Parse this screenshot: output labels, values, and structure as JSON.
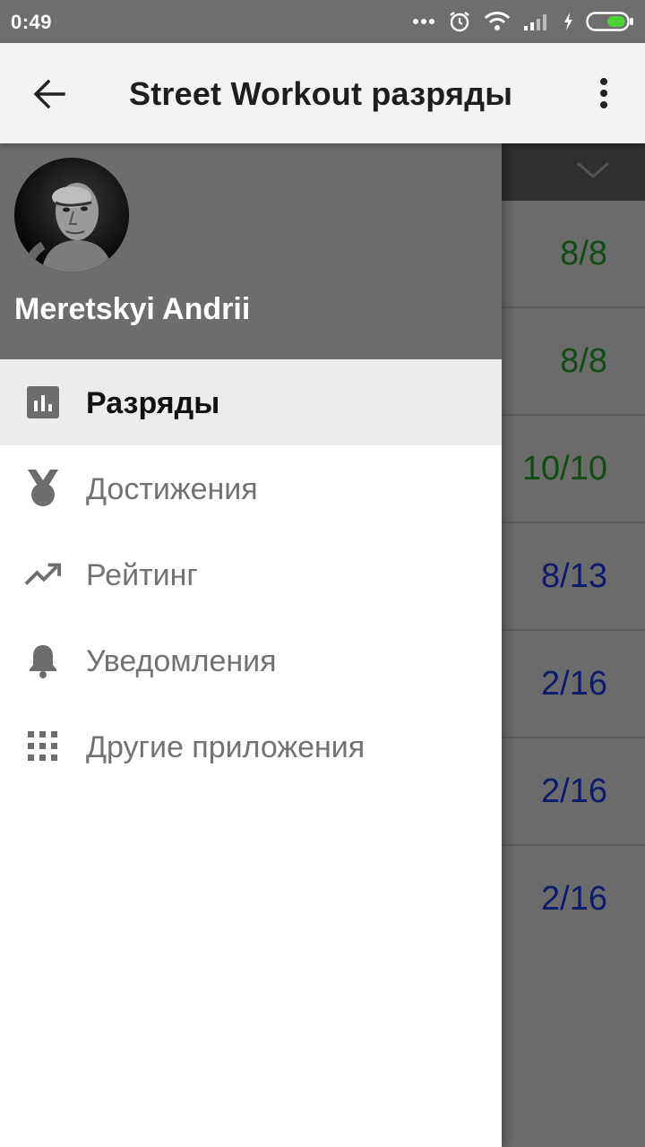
{
  "status_bar": {
    "time": "0:49"
  },
  "app_bar": {
    "title": "Street Workout разряды"
  },
  "drawer": {
    "user_name": "Meretskyi Andrii",
    "items": [
      {
        "label": "Разряды",
        "icon": "bar-chart-icon",
        "active": true
      },
      {
        "label": "Достижения",
        "icon": "medal-icon",
        "active": false
      },
      {
        "label": "Рейтинг",
        "icon": "trending-up-icon",
        "active": false
      },
      {
        "label": "Уведомления",
        "icon": "bell-icon",
        "active": false
      },
      {
        "label": "Другие приложения",
        "icon": "grid-icon",
        "active": false
      }
    ]
  },
  "background_list": {
    "values": [
      "8/8",
      "8/8",
      "10/10",
      "8/13",
      "2/16",
      "2/16",
      "2/16"
    ],
    "colors": [
      "#0f4d12",
      "#0f4d12",
      "#0f4d12",
      "#0d1a6e",
      "#0d1a6e",
      "#0d1a6e",
      "#0d1a6e"
    ]
  },
  "colors": {
    "status_bar": "#6e6e6e",
    "app_bar": "#f3f3f3",
    "drawer_header": "#6d6d6d",
    "active_item_bg": "#ececec",
    "complete_value": "#0f4d12",
    "partial_value": "#0d1a6e"
  }
}
